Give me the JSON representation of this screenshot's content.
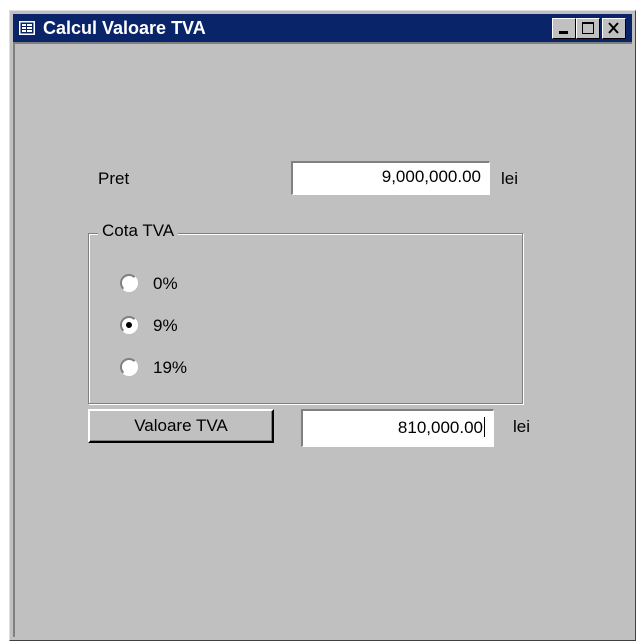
{
  "window": {
    "title": "Calcul Valoare TVA"
  },
  "form": {
    "pret_label": "Pret",
    "pret_value": "9,000,000.00",
    "pret_unit": "lei",
    "group_label": "Cota TVA",
    "options": [
      {
        "label": "0%",
        "selected": false
      },
      {
        "label": "9%",
        "selected": true
      },
      {
        "label": "19%",
        "selected": false
      }
    ],
    "button_label": "Valoare TVA",
    "result_value": "810,000.00",
    "result_unit": "lei"
  }
}
